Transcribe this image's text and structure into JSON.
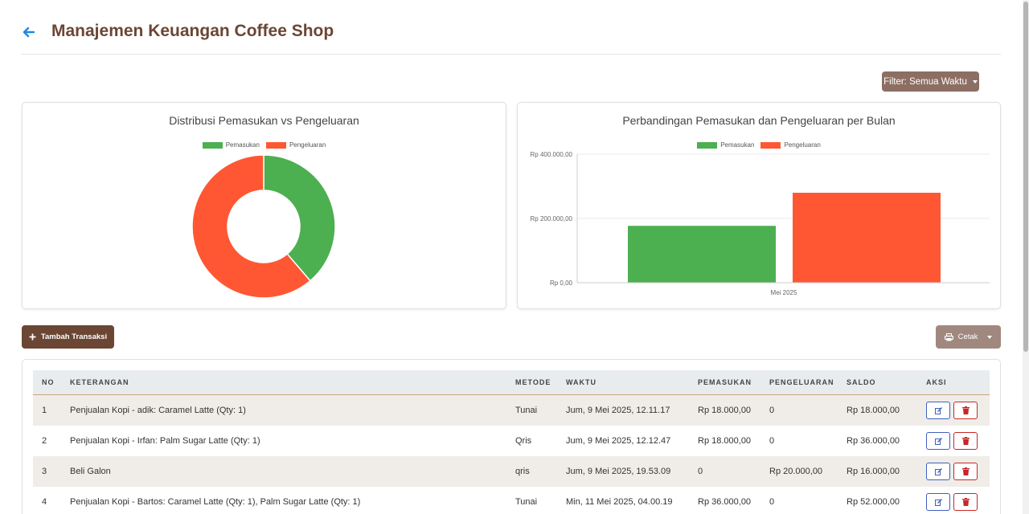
{
  "header": {
    "title": "Manajemen Keuangan Coffee Shop"
  },
  "filter": {
    "label": "Filter: Semua Waktu"
  },
  "pie_chart": {
    "title": "Distribusi Pemasukan vs Pengeluaran",
    "legend": [
      "Pemasukan",
      "Pengeluaran"
    ]
  },
  "bar_chart": {
    "title": "Perbandingan Pemasukan dan Pengeluaran per Bulan",
    "legend": [
      "Pemasukan",
      "Pengeluaran"
    ],
    "ticks": [
      "Rp 400.000,00",
      "Rp 200.000,00",
      "Rp 0,00"
    ],
    "category": "Mei 2025"
  },
  "chart_data": [
    {
      "type": "pie",
      "title": "Distribusi Pemasukan vs Pengeluaran",
      "labels": [
        "Pemasukan",
        "Pengeluaran"
      ],
      "values": [
        177000,
        280000
      ],
      "colors": [
        "#4caf50",
        "#ff5733"
      ]
    },
    {
      "type": "bar",
      "title": "Perbandingan Pemasukan dan Pengeluaran per Bulan",
      "categories": [
        "Mei 2025"
      ],
      "series": [
        {
          "name": "Pemasukan",
          "values": [
            177000
          ],
          "color": "#4caf50"
        },
        {
          "name": "Pengeluaran",
          "values": [
            280000
          ],
          "color": "#ff5733"
        }
      ],
      "ylim": [
        0,
        400000
      ],
      "yticks": [
        "Rp 0,00",
        "Rp 200.000,00",
        "Rp 400.000,00"
      ]
    }
  ],
  "actions": {
    "add_label": "Tambah Transaksi",
    "print_label": "Cetak"
  },
  "table": {
    "headers": {
      "no": "NO",
      "keterangan": "KETERANGAN",
      "metode": "METODE",
      "waktu": "WAKTU",
      "pemasukan": "PEMASUKAN",
      "pengeluaran": "PENGELUARAN",
      "saldo": "SALDO",
      "aksi": "AKSI"
    },
    "rows": [
      {
        "no": "1",
        "keterangan": "Penjualan Kopi - adik: Caramel Latte (Qty: 1)",
        "metode": "Tunai",
        "waktu": "Jum, 9 Mei 2025, 12.11.17",
        "pemasukan": "Rp 18.000,00",
        "pengeluaran": "0",
        "saldo": "Rp 18.000,00"
      },
      {
        "no": "2",
        "keterangan": "Penjualan Kopi - Irfan: Palm Sugar Latte (Qty: 1)",
        "metode": "Qris",
        "waktu": "Jum, 9 Mei 2025, 12.12.47",
        "pemasukan": "Rp 18.000,00",
        "pengeluaran": "0",
        "saldo": "Rp 36.000,00"
      },
      {
        "no": "3",
        "keterangan": "Beli Galon",
        "metode": "qris",
        "waktu": "Jum, 9 Mei 2025, 19.53.09",
        "pemasukan": "0",
        "pengeluaran": "Rp 20.000,00",
        "saldo": "Rp 16.000,00"
      },
      {
        "no": "4",
        "keterangan": "Penjualan Kopi - Bartos: Caramel Latte (Qty: 1), Palm Sugar Latte (Qty: 1)",
        "metode": "Tunai",
        "waktu": "Min, 11 Mei 2025, 04.00.19",
        "pemasukan": "Rp 36.000,00",
        "pengeluaran": "0",
        "saldo": "Rp 52.000,00"
      }
    ]
  }
}
